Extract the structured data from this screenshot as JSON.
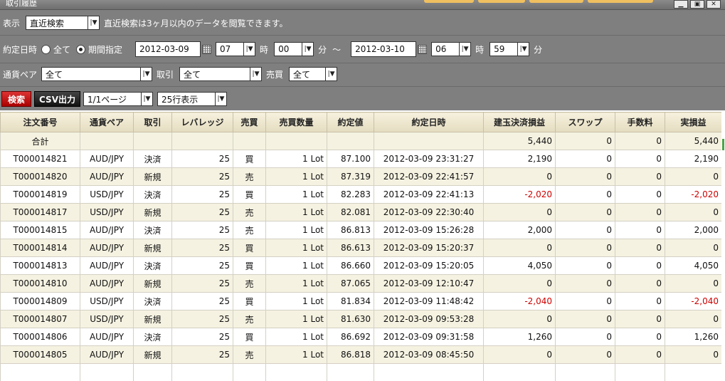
{
  "window": {
    "title": "取引履歴",
    "minimize": "▁",
    "maximize": "▣",
    "close": "✕"
  },
  "filters": {
    "display_label": "表示",
    "display_value": "直近検索",
    "display_note": "直近検索は3ヶ月以内のデータを閲覧できます。",
    "exec_datetime_label": "約定日時",
    "radio_all_label": "全て",
    "radio_period_label": "期間指定",
    "from_date": "2012-03-09",
    "from_hour": "07",
    "hour_unit": "時",
    "from_min": "00",
    "min_unit": "分",
    "range_sep": "～",
    "to_date": "2012-03-10",
    "to_hour": "06",
    "to_min": "59",
    "pair_label": "通貨ペア",
    "pair_value": "全て",
    "trade_label": "取引",
    "trade_value": "全て",
    "side_label": "売買",
    "side_value": "全て",
    "search_button": "検索",
    "csv_button": "CSV出力",
    "page_value": "1/1ページ",
    "rows_value": "25行表示"
  },
  "table": {
    "headers": [
      "注文番号",
      "通貨ペア",
      "取引",
      "レバレッジ",
      "売買",
      "売買数量",
      "約定値",
      "約定日時",
      "建玉決済損益",
      "スワップ",
      "手数料",
      "実損益"
    ],
    "total_label": "合計",
    "totals": {
      "pl": "5,440",
      "swap": "0",
      "fee": "0",
      "real": "5,440"
    },
    "rows": [
      [
        "T000014821",
        "AUD/JPY",
        "決済",
        "25",
        "買",
        "1 Lot",
        "87.100",
        "2012-03-09 23:31:27",
        "2,190",
        "0",
        "0",
        "2,190"
      ],
      [
        "T000014820",
        "AUD/JPY",
        "新規",
        "25",
        "売",
        "1 Lot",
        "87.319",
        "2012-03-09 22:41:57",
        "0",
        "0",
        "0",
        "0"
      ],
      [
        "T000014819",
        "USD/JPY",
        "決済",
        "25",
        "買",
        "1 Lot",
        "82.283",
        "2012-03-09 22:41:13",
        "-2,020",
        "0",
        "0",
        "-2,020"
      ],
      [
        "T000014817",
        "USD/JPY",
        "新規",
        "25",
        "売",
        "1 Lot",
        "82.081",
        "2012-03-09 22:30:40",
        "0",
        "0",
        "0",
        "0"
      ],
      [
        "T000014815",
        "AUD/JPY",
        "決済",
        "25",
        "売",
        "1 Lot",
        "86.813",
        "2012-03-09 15:26:28",
        "2,000",
        "0",
        "0",
        "2,000"
      ],
      [
        "T000014814",
        "AUD/JPY",
        "新規",
        "25",
        "買",
        "1 Lot",
        "86.613",
        "2012-03-09 15:20:37",
        "0",
        "0",
        "0",
        "0"
      ],
      [
        "T000014813",
        "AUD/JPY",
        "決済",
        "25",
        "買",
        "1 Lot",
        "86.660",
        "2012-03-09 15:20:05",
        "4,050",
        "0",
        "0",
        "4,050"
      ],
      [
        "T000014810",
        "AUD/JPY",
        "新規",
        "25",
        "売",
        "1 Lot",
        "87.065",
        "2012-03-09 12:10:47",
        "0",
        "0",
        "0",
        "0"
      ],
      [
        "T000014809",
        "USD/JPY",
        "決済",
        "25",
        "買",
        "1 Lot",
        "81.834",
        "2012-03-09 11:48:42",
        "-2,040",
        "0",
        "0",
        "-2,040"
      ],
      [
        "T000014807",
        "USD/JPY",
        "新規",
        "25",
        "売",
        "1 Lot",
        "81.630",
        "2012-03-09 09:53:28",
        "0",
        "0",
        "0",
        "0"
      ],
      [
        "T000014806",
        "AUD/JPY",
        "決済",
        "25",
        "買",
        "1 Lot",
        "86.692",
        "2012-03-09 09:31:58",
        "1,260",
        "0",
        "0",
        "1,260"
      ],
      [
        "T000014805",
        "AUD/JPY",
        "新規",
        "25",
        "売",
        "1 Lot",
        "86.818",
        "2012-03-09 08:45:50",
        "0",
        "0",
        "0",
        "0"
      ]
    ]
  },
  "colors": {
    "panel_bg": "#7f7f7f",
    "row_alt": "#f5f2e1",
    "negative": "#d00000",
    "search_button": "#c01010"
  },
  "icons": {
    "dropdown": "chevron-down-icon",
    "calendar": "calendar-icon"
  }
}
